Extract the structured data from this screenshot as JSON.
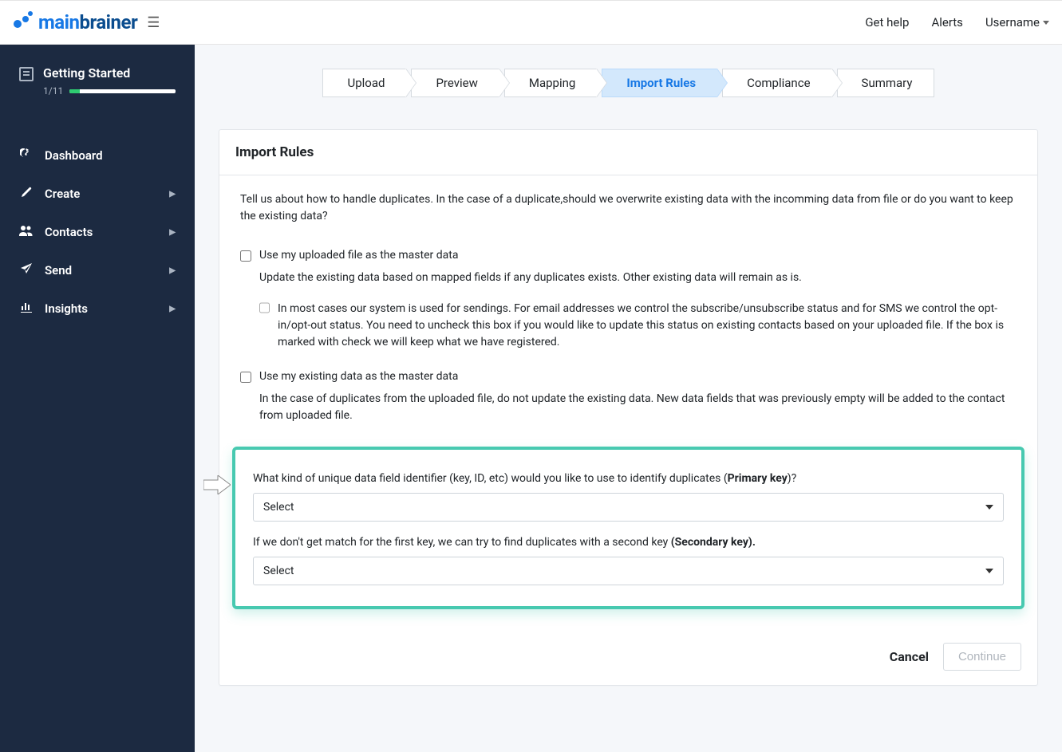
{
  "brand": {
    "main": "main",
    "sub": "brainer"
  },
  "topnav": {
    "help": "Get help",
    "alerts": "Alerts",
    "username": "Username"
  },
  "sidebar": {
    "getting_started": {
      "title": "Getting Started",
      "count": "1/11"
    },
    "items": [
      {
        "label": "Dashboard",
        "has_children": false
      },
      {
        "label": "Create",
        "has_children": true
      },
      {
        "label": "Contacts",
        "has_children": true
      },
      {
        "label": "Send",
        "has_children": true
      },
      {
        "label": "Insights",
        "has_children": true
      }
    ]
  },
  "steps": [
    {
      "label": "Upload",
      "active": false
    },
    {
      "label": "Preview",
      "active": false
    },
    {
      "label": "Mapping",
      "active": false
    },
    {
      "label": "Import Rules",
      "active": true
    },
    {
      "label": "Compliance",
      "active": false
    },
    {
      "label": "Summary",
      "active": false
    }
  ],
  "card": {
    "title": "Import Rules",
    "intro": "Tell us about how to handle duplicates. In the case of a duplicate,should we overwrite existing data with the incomming data from file or do you want to keep the existing data?",
    "opt1_label": "Use my uploaded file as the master data",
    "opt1_desc": "Update the existing data based on mapped fields if any duplicates exists. Other existing data will remain as is.",
    "opt1_sub": "In most cases our system is used for sendings. For email addresses we control the subscribe/unsubscribe status and for SMS we control the opt-in/opt-out status. You need to uncheck this box if you would like to update this status on existing contacts based on your uploaded file. If the box is marked with check we will keep what we have registered.",
    "opt2_label": "Use my existing data as the master data",
    "opt2_desc": "In the case of duplicates from the uploaded file, do not update the existing data. New data fields that was previously empty will be added to the contact from uploaded file.",
    "q1_pre": "What kind of unique data field identifier (key, ID, etc) would you like to use to identify duplicates (",
    "q1_bold": "Primary key",
    "q1_post": ")?",
    "q2_pre": "If we don't get match for the first key, we can try to find duplicates with a second key ",
    "q2_bold": "(Secondary key).",
    "select_placeholder": "Select",
    "cancel": "Cancel",
    "continue": "Continue"
  }
}
